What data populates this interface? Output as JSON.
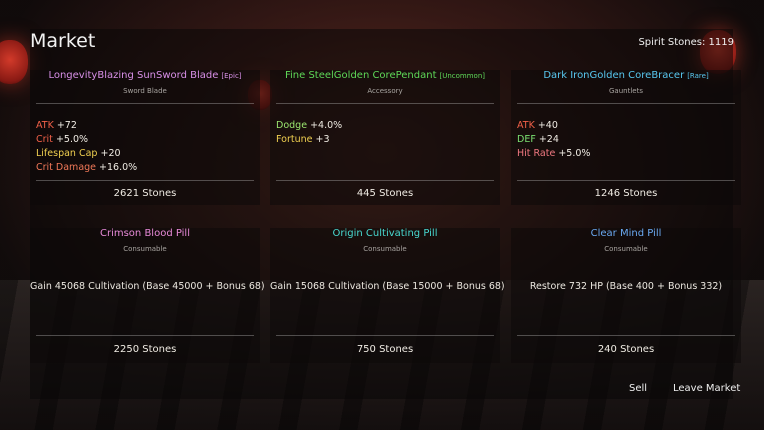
{
  "header": {
    "title": "Market",
    "spirit_stones_label": "Spirit Stones: 1119"
  },
  "equipment": [
    {
      "name": "LongevityBlazing SunSword Blade",
      "rarity": "[Epic]",
      "type": "Sword Blade",
      "name_color": "#d890e8",
      "stats": [
        {
          "label": "ATK",
          "value": "+72",
          "color": "#f06048"
        },
        {
          "label": "Crit",
          "value": "+5.0%",
          "color": "#f06048"
        },
        {
          "label": "Lifespan Cap",
          "value": "+20",
          "color": "#f0d050"
        },
        {
          "label": "Crit Damage",
          "value": "+16.0%",
          "color": "#f07858"
        }
      ],
      "price": "2621 Stones"
    },
    {
      "name": "Fine SteelGolden CorePendant",
      "rarity": "[Uncommon]",
      "type": "Accessory",
      "name_color": "#5ed858",
      "stats": [
        {
          "label": "Dodge",
          "value": "+4.0%",
          "color": "#9ce870"
        },
        {
          "label": "Fortune",
          "value": "+3",
          "color": "#f0d050"
        }
      ],
      "price": "445 Stones"
    },
    {
      "name": "Dark IronGolden CoreBracer",
      "rarity": "[Rare]",
      "type": "Gauntlets",
      "name_color": "#58c8f0",
      "stats": [
        {
          "label": "ATK",
          "value": "+40",
          "color": "#f06048"
        },
        {
          "label": "DEF",
          "value": "+24",
          "color": "#7ae070"
        },
        {
          "label": "Hit Rate",
          "value": "+5.0%",
          "color": "#f07880"
        }
      ],
      "price": "1246 Stones"
    }
  ],
  "consumables": [
    {
      "name": "Crimson Blood Pill",
      "type": "Consumable",
      "name_color": "#e88ad8",
      "description": "Gain 45068 Cultivation (Base 45000 + Bonus 68)",
      "price": "2250 Stones"
    },
    {
      "name": "Origin Cultivating Pill",
      "type": "Consumable",
      "name_color": "#48d8d0",
      "description": "Gain 15068 Cultivation (Base 15000 + Bonus 68)",
      "price": "750 Stones"
    },
    {
      "name": "Clear Mind Pill",
      "type": "Consumable",
      "name_color": "#6aa8f0",
      "description": "Restore 732 HP (Base 400 + Bonus 332)",
      "price": "240 Stones"
    }
  ],
  "footer": {
    "sell_label": "Sell",
    "leave_label": "Leave Market"
  }
}
